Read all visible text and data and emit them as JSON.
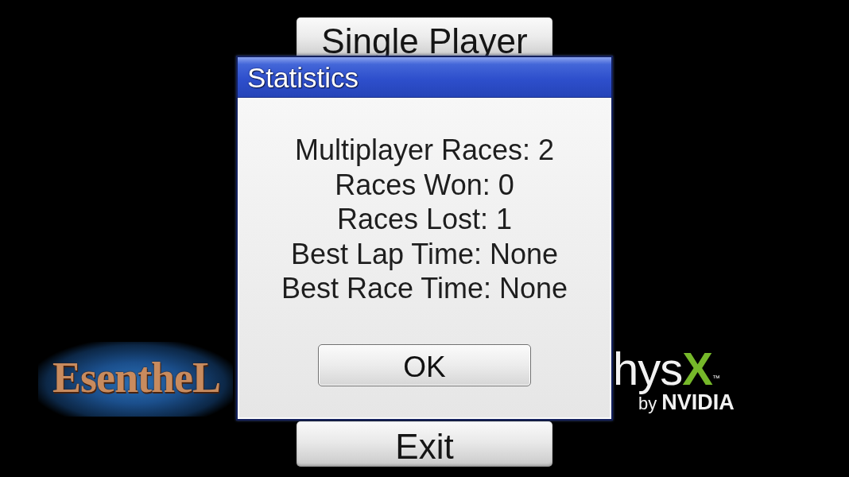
{
  "menu": {
    "buttons": [
      {
        "label": "Single Player"
      },
      {
        "label": "Exit"
      }
    ]
  },
  "logos": {
    "left": {
      "text": "EsentheL"
    },
    "right": {
      "text": "hys",
      "accent": "X",
      "trademark": "™",
      "tagline": "by **NVIDIA**"
    }
  },
  "dialog": {
    "title": "Statistics",
    "lines": [
      "Multiplayer Races: 2",
      "Races Won: 0",
      "Races Lost: 1",
      "Best Lap Time: None",
      "Best Race Time: None"
    ],
    "buttons": [
      {
        "label": "OK"
      }
    ]
  }
}
